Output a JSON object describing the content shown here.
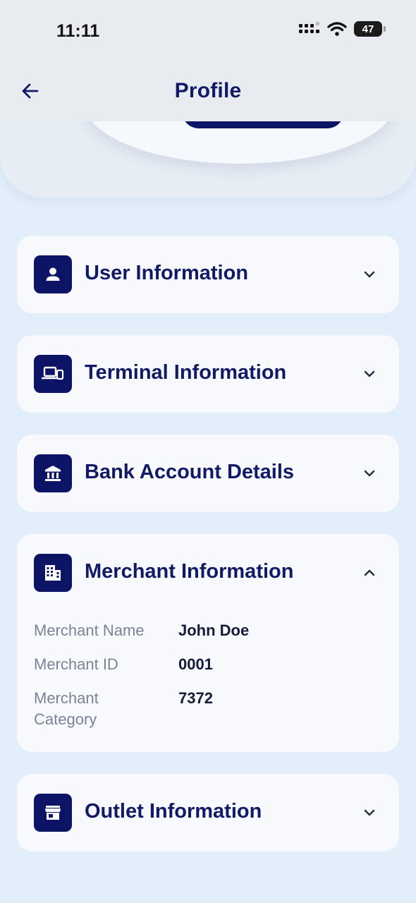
{
  "status": {
    "time": "11:11",
    "battery": "47"
  },
  "header": {
    "title": "Profile"
  },
  "sections": [
    {
      "title": "User Information",
      "expanded": false,
      "icon": "person-icon"
    },
    {
      "title": "Terminal Information",
      "expanded": false,
      "icon": "devices-icon"
    },
    {
      "title": "Bank Account Details",
      "expanded": false,
      "icon": "bank-icon"
    },
    {
      "title": "Merchant Information",
      "expanded": true,
      "icon": "building-icon",
      "fields": [
        {
          "label": "Merchant Name",
          "value": "John Doe"
        },
        {
          "label": "Merchant ID",
          "value": "0001"
        },
        {
          "label": "Merchant Category",
          "value": "7372"
        }
      ]
    },
    {
      "title": "Outlet Information",
      "expanded": false,
      "icon": "store-icon"
    }
  ],
  "colors": {
    "accent": "#0d1466",
    "background": "#e3eefb",
    "card": "#f7f9fc",
    "label": "#7b8497"
  }
}
